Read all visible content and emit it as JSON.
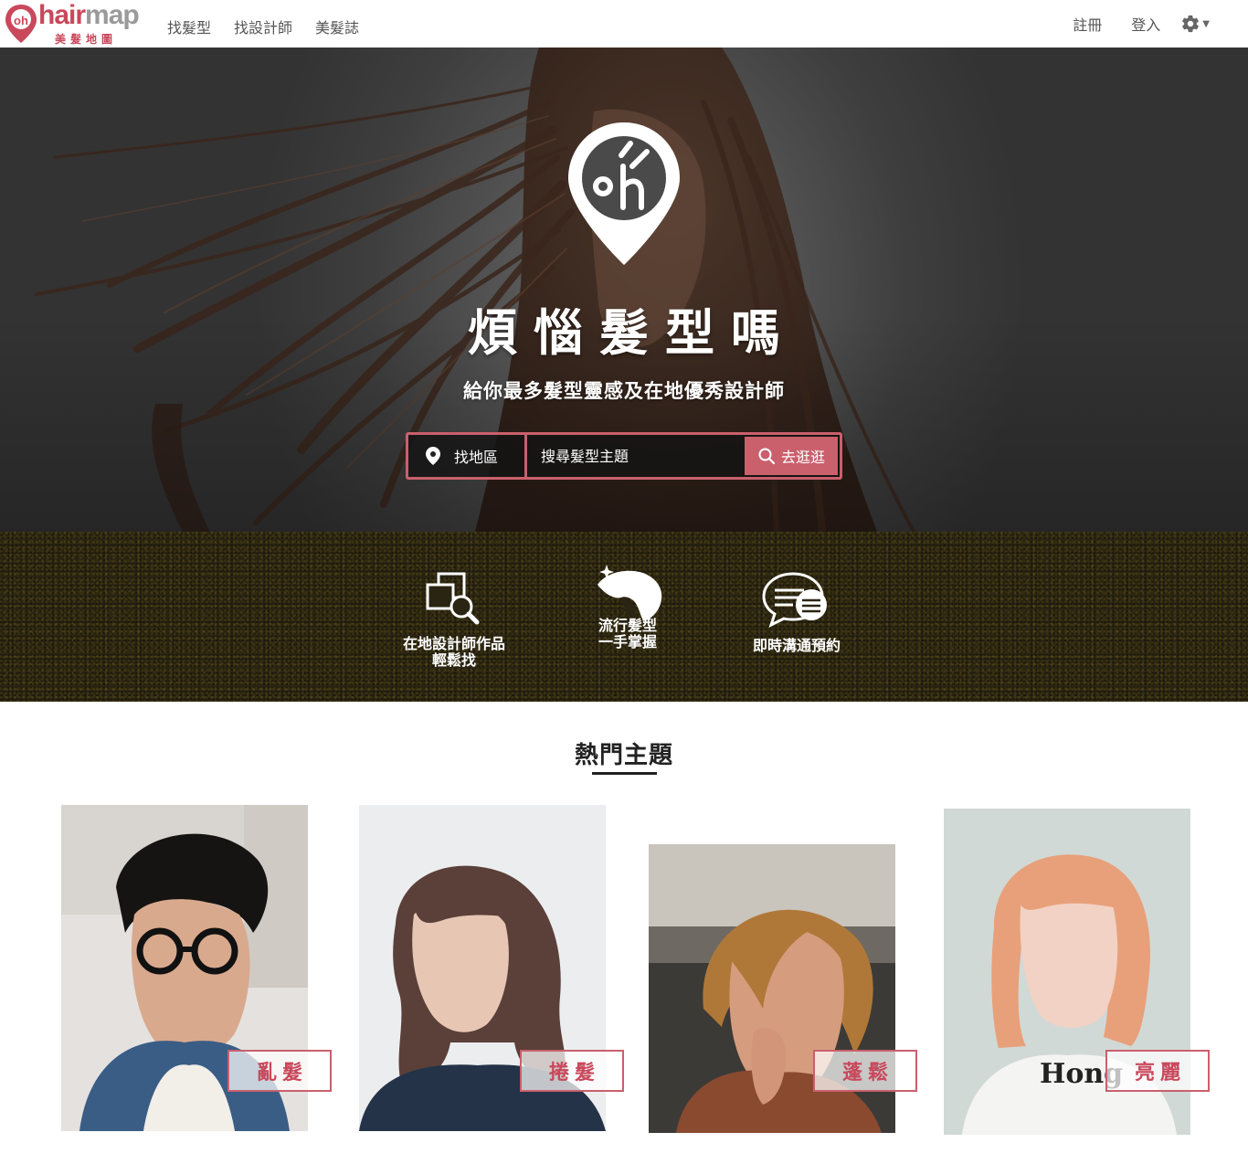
{
  "nav": {
    "logo_text_1": "hair",
    "logo_text_2": "map",
    "logo_sub": "美髮地圖",
    "links": [
      "找髮型",
      "找設計師",
      "美髮誌"
    ],
    "register": "註冊",
    "login": "登入",
    "settings_icon": "gear-icon"
  },
  "hero": {
    "title": "煩惱髮型嗎",
    "subtitle": "給你最多髮型靈感及在地優秀設計師",
    "region_label": "找地區",
    "search_placeholder": "搜尋髮型主題",
    "search_button": "去逛逛"
  },
  "features": [
    {
      "icon": "photo-search-icon",
      "label": "在地設計師作品\n輕鬆找"
    },
    {
      "icon": "hair-silhouette-icon",
      "label": "流行髮型\n一手掌握"
    },
    {
      "icon": "chat-bubbles-icon",
      "label": "即時溝通預約"
    }
  ],
  "topics": {
    "title": "熱門主題",
    "items": [
      {
        "tag": "亂髮"
      },
      {
        "tag": "捲髮"
      },
      {
        "tag": "蓬鬆"
      },
      {
        "tag": "亮麗"
      }
    ]
  },
  "colors": {
    "brand": "#c9485b",
    "accent": "#c9606c",
    "band": "#2a2412"
  }
}
